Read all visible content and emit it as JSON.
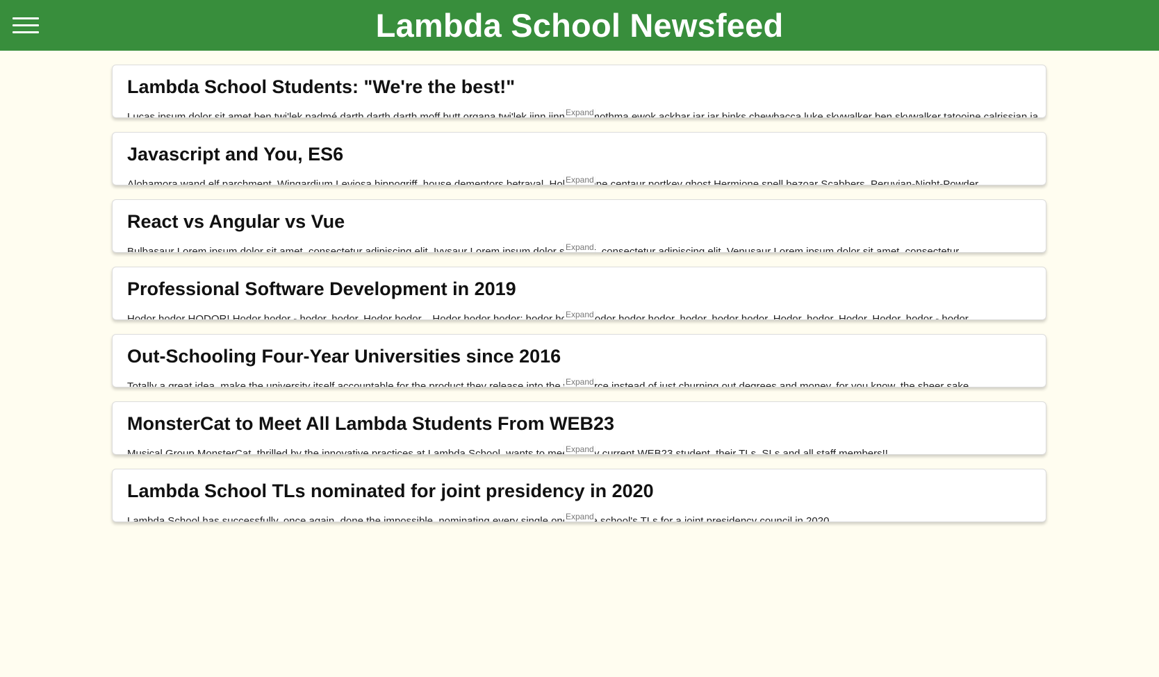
{
  "header": {
    "title": "Lambda School Newsfeed"
  },
  "expand_label": "Expand",
  "articles": [
    {
      "title": "Lambda School Students: \"We're the best!\"",
      "body": "Lucas ipsum dolor sit amet ben twi'lek padmé darth darth darth moff butt organa twi'lek jinn jinn mon mothma ewok ackbar jar jar binks chewbacca luke skywalker ben skywalker tatooine calrissian jango fett bespin vader kessel mandalore naboo"
    },
    {
      "title": "Javascript and You, ES6",
      "body": "Alohamora wand elf parchment, Wingardium Leviosa hippogriff, house dementors betrayal. Holly, Snape centaur portkey ghost Hermione spell bezoar Scabbers. Peruvian-Night-Powder"
    },
    {
      "title": "React vs Angular vs Vue",
      "body": "Bulbasaur Lorem ipsum dolor sit amet, consectetur adipiscing elit. Ivysaur Lorem ipsum dolor sit amet, consectetur adipiscing elit. Venusaur Lorem ipsum dolor sit amet, consectetur"
    },
    {
      "title": "Professional Software Development in 2019",
      "body": "Hodor hodor HODOR! Hodor hodor - hodor, hodor. Hodor hodor... Hodor hodor hodor; hodor hodor. Hodor hodor hodor, hodor, hodor hodor. Hodor, hodor. Hodor. Hodor, hodor - hodor"
    },
    {
      "title": "Out-Schooling Four-Year Universities since 2016",
      "body": "Totally a great idea, make the university itself accountable for the product they release into the workforce instead of just churning out degrees and money, for you know, the sheer sake"
    },
    {
      "title": "MonsterCat to Meet All Lambda Students From WEB23",
      "body": "Musical Group MonsterCat, thrilled by the innovative practices at Lambda School, wants to meet every current WEB23 student, their TLs, SLs and all staff members!!"
    },
    {
      "title": "Lambda School TLs nominated for joint presidency in 2020",
      "body": "Lambda School has successfully, once again, done the impossible, nominating every single one of the school's TLs for a joint presidency council in 2020."
    }
  ],
  "colors": {
    "header_bg": "#388e3c",
    "page_bg": "#fffdf0"
  }
}
